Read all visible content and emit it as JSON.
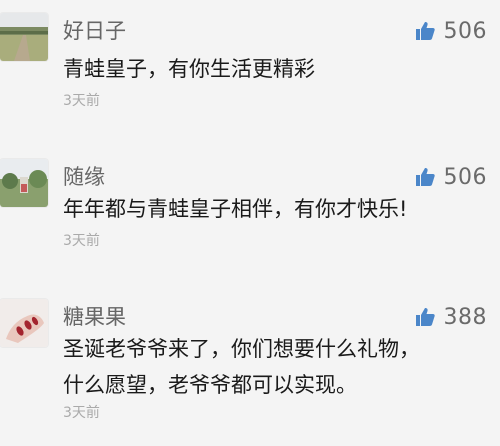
{
  "accent_color": "#4b86c9",
  "comments": [
    {
      "username": "好日子",
      "likes": "506",
      "lines": [
        "青蛙皇子，有你生活更精彩"
      ],
      "time": "3天前",
      "avatar": "road-landscape-avatar"
    },
    {
      "username": "随缘",
      "likes": "506",
      "lines": [
        "年年都与青蛙皇子相伴，有你才快乐!"
      ],
      "time": "3天前",
      "avatar": "park-scene-avatar"
    },
    {
      "username": "糖果果",
      "likes": "388",
      "lines": [
        "圣诞老爷爷来了，你们想要什么礼物，",
        "什么愿望，老爷爷都可以实现。"
      ],
      "time": "3天前",
      "avatar": "hand-red-nails-avatar"
    }
  ]
}
